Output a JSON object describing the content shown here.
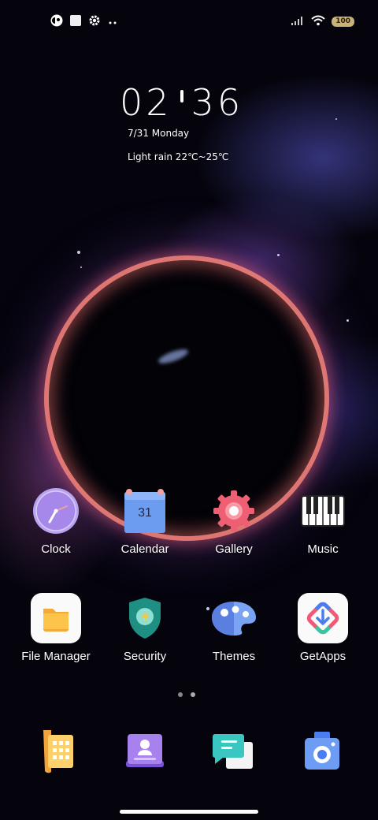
{
  "status_bar": {
    "battery": "100"
  },
  "clock_widget": {
    "hours": "02",
    "minutes": "36",
    "date": "7/31 Monday",
    "weather": "Light rain 22℃~25℃"
  },
  "apps": [
    {
      "label": "Clock",
      "icon": "clock-icon"
    },
    {
      "label": "Calendar",
      "icon": "calendar-icon",
      "day": "31"
    },
    {
      "label": "Gallery",
      "icon": "gallery-icon"
    },
    {
      "label": "Music",
      "icon": "music-icon"
    },
    {
      "label": "File Manager",
      "icon": "folder-icon"
    },
    {
      "label": "Security",
      "icon": "shield-icon"
    },
    {
      "label": "Themes",
      "icon": "palette-icon"
    },
    {
      "label": "GetApps",
      "icon": "getapps-icon"
    }
  ],
  "dock": [
    {
      "icon": "phone-icon"
    },
    {
      "icon": "contacts-icon"
    },
    {
      "icon": "messages-icon"
    },
    {
      "icon": "camera-icon"
    }
  ],
  "pages": {
    "count": 2,
    "current": 2
  }
}
